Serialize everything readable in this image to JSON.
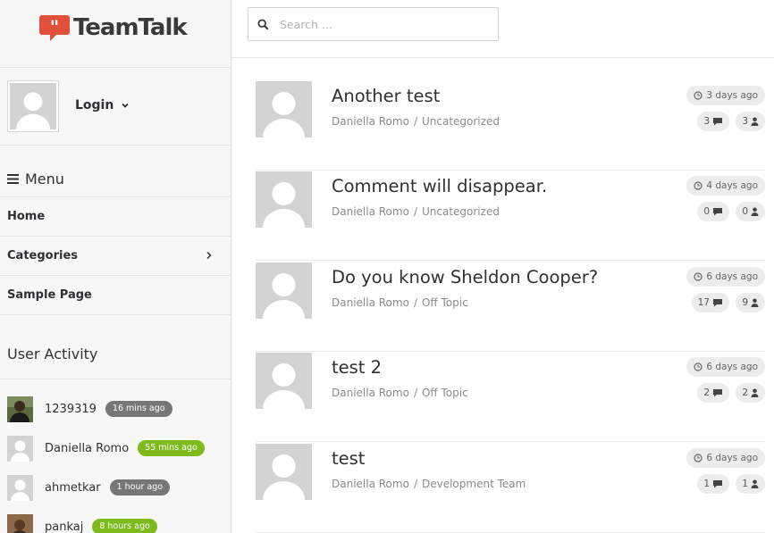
{
  "brand": {
    "name": "TeamTalk",
    "logo_color": "#e1503a"
  },
  "user": {
    "login_label": "Login"
  },
  "menu": {
    "title": "Menu",
    "items": [
      {
        "label": "Home"
      },
      {
        "label": "Categories"
      },
      {
        "label": "Sample Page"
      }
    ]
  },
  "user_activity": {
    "title": "User Activity",
    "entries": [
      {
        "name": "1239319",
        "time": "16 mins ago",
        "badge_color": "#777777"
      },
      {
        "name": "Daniella Romo",
        "time": "55 mins ago",
        "badge_color": "#7cbb1b"
      },
      {
        "name": "ahmetkar",
        "time": "1 hour ago",
        "badge_color": "#777777"
      },
      {
        "name": "pankaj",
        "time": "8 hours ago",
        "badge_color": "#7cbb1b"
      }
    ]
  },
  "search": {
    "placeholder": "Search ..."
  },
  "posts": [
    {
      "title": "Another test",
      "author": "Daniella Romo",
      "category": "Uncategorized",
      "time": "3 days ago",
      "comments": "3",
      "participants": "3"
    },
    {
      "title": "Comment will disappear.",
      "author": "Daniella Romo",
      "category": "Uncategorized",
      "time": "4 days ago",
      "comments": "0",
      "participants": "0"
    },
    {
      "title": "Do you know Sheldon Cooper?",
      "author": "Daniella Romo",
      "category": "Off Topic",
      "time": "6 days ago",
      "comments": "17",
      "participants": "9"
    },
    {
      "title": "test 2",
      "author": "Daniella Romo",
      "category": "Off Topic",
      "time": "6 days ago",
      "comments": "2",
      "participants": "2"
    },
    {
      "title": "test",
      "author": "Daniella Romo",
      "category": "Development Team",
      "time": "6 days ago",
      "comments": "1",
      "participants": "1"
    }
  ],
  "separator": "/"
}
